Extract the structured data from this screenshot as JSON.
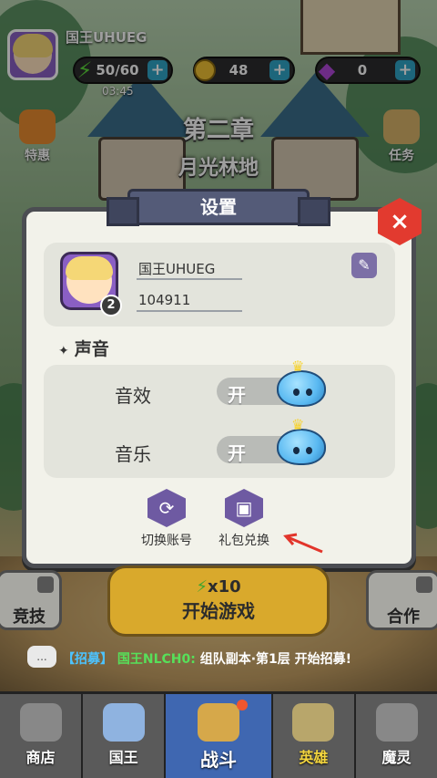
{
  "hud": {
    "player_name": "国王UHUEG",
    "energy": "50/60",
    "energy_timer": "03:45",
    "gold": "48",
    "gems": "0",
    "plus": "+"
  },
  "chapter": {
    "title": "第二章",
    "subtitle": "月光林地"
  },
  "side": {
    "left_top": "特惠",
    "right_top": "任务"
  },
  "settings": {
    "title": "设置",
    "close": "×",
    "profile": {
      "name": "国王UHUEG",
      "id": "104911",
      "level": "2",
      "edit_icon": "edit-icon"
    },
    "sound_section": "声音",
    "rows": [
      {
        "label": "音效",
        "state": "开"
      },
      {
        "label": "音乐",
        "state": "开"
      }
    ],
    "actions": [
      {
        "label": "切换账号",
        "icon": "switch-account-icon"
      },
      {
        "label": "礼包兑换",
        "icon": "gift-icon"
      }
    ]
  },
  "bottom": {
    "start_cost": "x10",
    "start_label": "开始游戏",
    "left_corner": "竞技",
    "right_corner": "合作",
    "recruit_tag": "【招募】",
    "recruit_name": "国王NLCH0:",
    "recruit_msg": "组队副本·第1层 开始招募!",
    "chat_icon": "..."
  },
  "tabs": [
    {
      "label": "商店"
    },
    {
      "label": "国王"
    },
    {
      "label": "战斗"
    },
    {
      "label": "英雄"
    },
    {
      "label": "魔灵"
    }
  ],
  "colors": {
    "accent_purple": "#6e5aa2",
    "close_red": "#e23a2f",
    "active_tab": "#3f67b1",
    "start_gold": "#d9a92c"
  }
}
